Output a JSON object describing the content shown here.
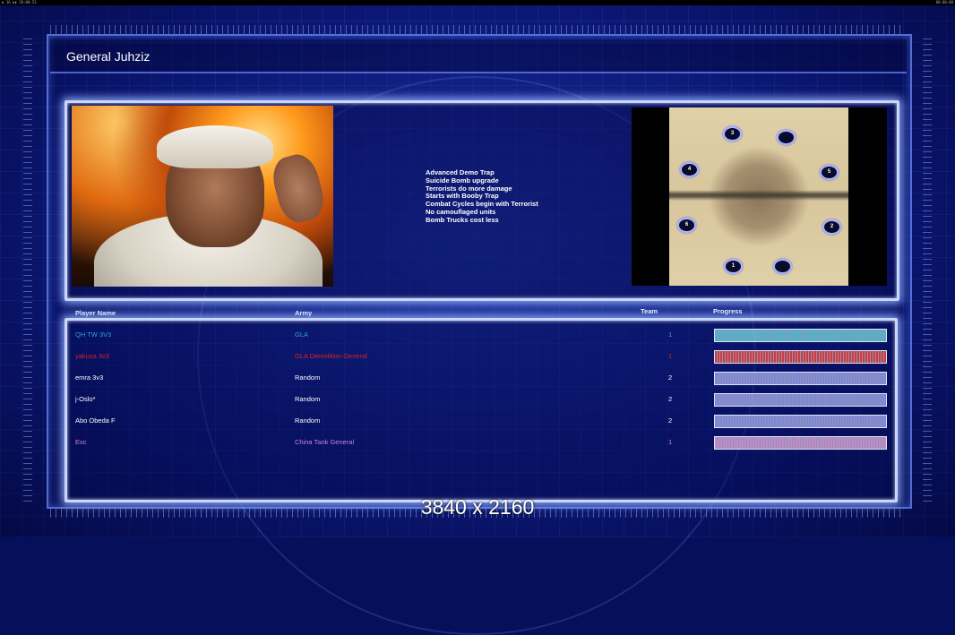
{
  "window": {
    "top_left_text": "▮ 16 ▮▮ 20:00:53",
    "top_right_text": "00:00:00"
  },
  "title": "General Juhziz",
  "bonuses": [
    "Advanced Demo Trap",
    "Suicide Bomb upgrade",
    "Terrorists do more damage",
    "Starts with Booby Trap",
    "Combat Cycles begin with Terrorist",
    "No camouflaged units",
    "Bomb Trucks cost less"
  ],
  "minimap": {
    "markers": [
      "3",
      "",
      "4",
      "5",
      "6",
      "2",
      "1",
      ""
    ]
  },
  "table": {
    "headers": {
      "player": "Player Name",
      "army": "Army",
      "team": "Team",
      "progress": "Progress"
    },
    "rows": [
      {
        "name": "QH TW 3V3",
        "army": "GLA",
        "team": "1",
        "color": "#2fa6d8",
        "progress": 1.0
      },
      {
        "name": "yakuza 3v3",
        "army": "GLA Demolition General",
        "team": "1",
        "color": "#e02222",
        "progress": 1.0
      },
      {
        "name": "emra 3v3",
        "army": "Random",
        "team": "2",
        "color": "#ffffff",
        "progress": 1.0
      },
      {
        "name": "j-Oslo*",
        "army": "Random",
        "team": "2",
        "color": "#ffffff",
        "progress": 1.0
      },
      {
        "name": "Abo Obeda F",
        "army": "Random",
        "team": "2",
        "color": "#ffffff",
        "progress": 1.0
      },
      {
        "name": "Exc",
        "army": "China Tank General",
        "team": "1",
        "color": "#d27fd8",
        "progress": 1.0
      }
    ],
    "bar_colors": [
      "#4bb6c8",
      "#d23a3a",
      "#7f86d8",
      "#7f86d8",
      "#7f86d8",
      "#c48ac8"
    ]
  },
  "watermark": "3840 x 2160"
}
